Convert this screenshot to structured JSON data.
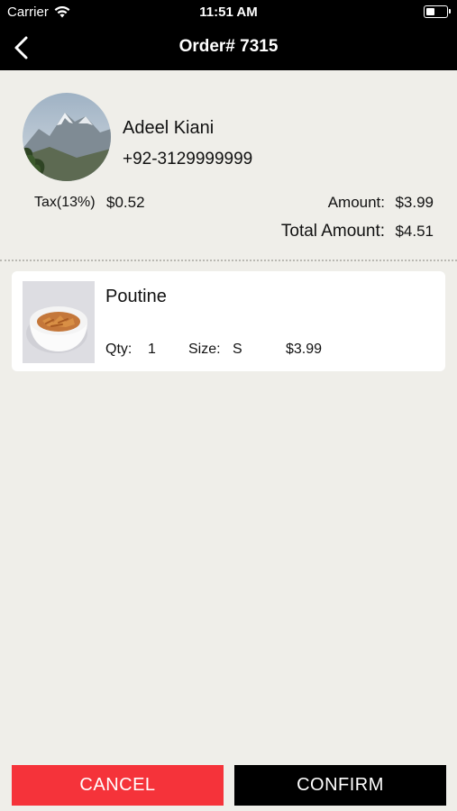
{
  "status_bar": {
    "carrier": "Carrier",
    "time": "11:51 AM",
    "wifi_icon": "wifi-icon",
    "battery_icon": "battery-icon"
  },
  "nav": {
    "title": "Order# 7315",
    "back_icon": "chevron-left-icon"
  },
  "customer": {
    "name": "Adeel Kiani",
    "phone": "+92-3129999999",
    "avatar": "mountain-photo"
  },
  "summary": {
    "tax_label": "Tax(13%)",
    "tax_value": "$0.52",
    "amount_label": "Amount:",
    "amount_value": "$3.99",
    "total_label": "Total Amount:",
    "total_value": "$4.51"
  },
  "items": [
    {
      "name": "Poutine",
      "image": "poutine-bowl-photo",
      "qty_label": "Qty:",
      "qty": "1",
      "size_label": "Size:",
      "size": "S",
      "price": "$3.99"
    }
  ],
  "actions": {
    "cancel_label": "CANCEL",
    "confirm_label": "CONFIRM"
  },
  "colors": {
    "background": "#efeee9",
    "bar": "#000000",
    "cancel": "#f5333a",
    "confirm": "#000000"
  }
}
